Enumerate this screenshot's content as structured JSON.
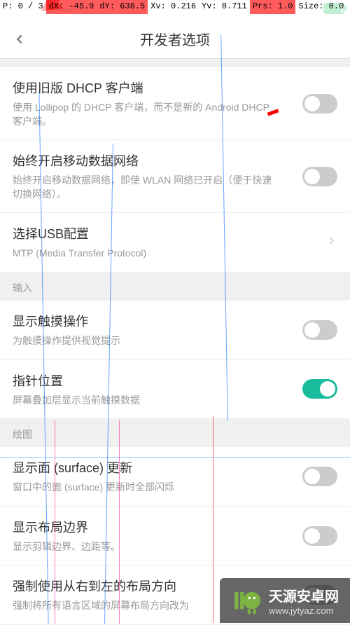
{
  "debug": {
    "p": "P: 0 / 3",
    "dx": "dX: -45.9",
    "dy": "dY: 638.5",
    "xv": "Xv: 0.216",
    "yv": "Yv: 8.711",
    "prs": "Prs: 1.0",
    "size": "Size: 0.0"
  },
  "header": {
    "title": "开发者选项"
  },
  "items": {
    "dhcp": {
      "title": "使用旧版 DHCP 客户端",
      "desc": "使用 Lollipop 的 DHCP 客户端，而不是新的 Android DHCP 客户端。"
    },
    "mobile": {
      "title": "始终开启移动数据网络",
      "desc": "始终开启移动数据网络，即使 WLAN 网络已开启（便于快速切换网络）。"
    },
    "usb": {
      "title": "选择USB配置",
      "desc": "MTP (Media Transfer Protocol)"
    },
    "touches": {
      "title": "显示触摸操作",
      "desc": "为触摸操作提供视觉提示"
    },
    "pointer": {
      "title": "指针位置",
      "desc": "屏幕叠加层显示当前触摸数据"
    },
    "surface": {
      "title": "显示面 (surface) 更新",
      "desc": "窗口中的面 (surface) 更新时全部闪烁"
    },
    "layout": {
      "title": "显示布局边界",
      "desc": "显示剪辑边界、边距等。"
    },
    "rtl": {
      "title": "强制使用从右到左的布局方向",
      "desc": "强制将所有语言区域的屏幕布局方向改为"
    }
  },
  "sections": {
    "input": "输入",
    "drawing": "绘图"
  },
  "watermark": {
    "title": "天源安卓网",
    "url": "www.jytyaz.com"
  }
}
